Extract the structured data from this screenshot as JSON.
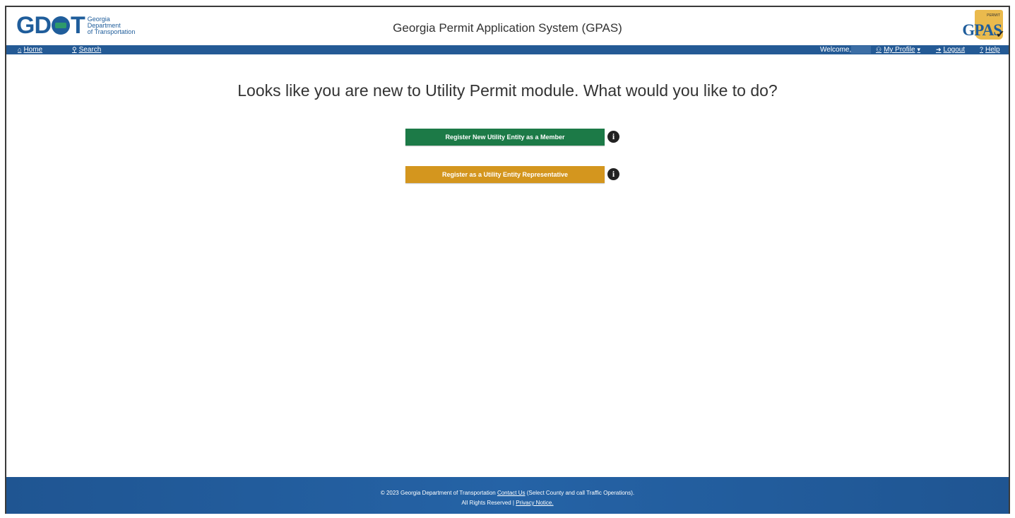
{
  "header": {
    "logo_text": "GDOT",
    "logo_sub": [
      "Georgia",
      "Department",
      "of Transportation"
    ],
    "title": "Georgia Permit Application System (GPAS)",
    "gpas_logo_text": "GPAS",
    "gpas_logo_permit": "PERMIT"
  },
  "nav": {
    "home": "Home",
    "search": "Search",
    "welcome": "Welcome,",
    "my_profile": "My Profile",
    "logout": "Logout",
    "help": "Help"
  },
  "main": {
    "heading": "Looks like you are new to Utility Permit module. What would you like to do?",
    "register_member": "Register New Utility Entity as a Member",
    "register_representative": "Register as a Utility Entity Representative",
    "info_glyph": "i"
  },
  "footer": {
    "copyright": "© 2023 Georgia Department of Transportation",
    "contact_us": "Contact Us",
    "contact_note": "(Select County and call Traffic Operations).",
    "rights": "All Rights Reserved |",
    "privacy": " Privacy Notice."
  },
  "colors": {
    "nav": "#245a95",
    "green_button": "#1c7a47",
    "gold_button": "#d4961e",
    "footer": "#2563a6"
  }
}
